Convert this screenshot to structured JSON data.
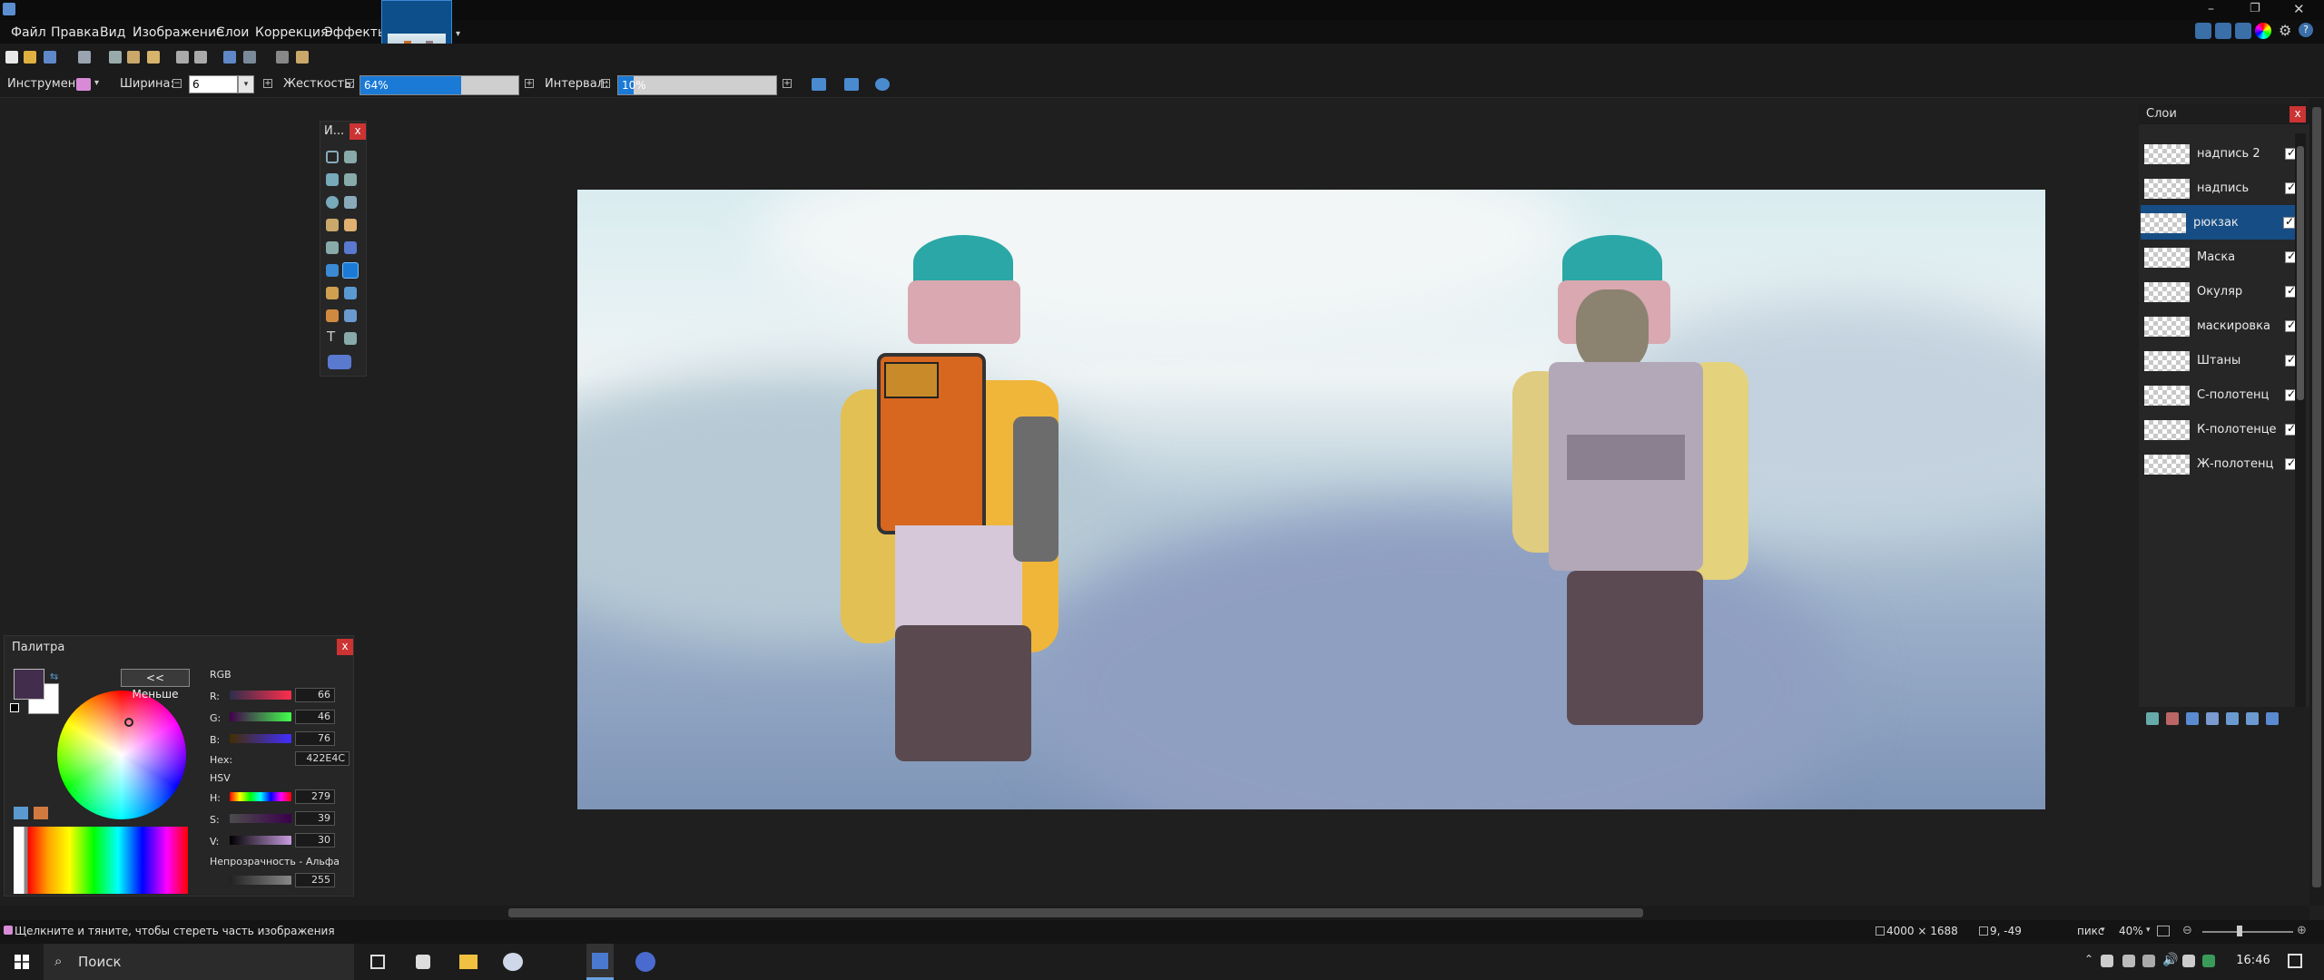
{
  "menu": [
    "Файл",
    "Правка",
    "Вид",
    "Изображение",
    "Слои",
    "Коррекция",
    "Эффекты"
  ],
  "toolbar": {
    "tool_label": "Инструмент:",
    "width_label": "Ширина:",
    "width_value": "6",
    "hardness_label": "Жесткость:",
    "hardness_value": "64%",
    "hardness_level": 0.64,
    "interval_label": "Интервал:",
    "interval_value": "10%",
    "interval_level": 0.1
  },
  "tools_panel": {
    "title": "И...",
    "close": "x"
  },
  "layers_panel": {
    "title": "Слои",
    "close": "x",
    "selected_index": 2,
    "items": [
      {
        "name": "надпись 2",
        "visible": true
      },
      {
        "name": "надпись",
        "visible": true
      },
      {
        "name": "рюкзак",
        "visible": true
      },
      {
        "name": "Маска",
        "visible": true
      },
      {
        "name": "Окуляр",
        "visible": true
      },
      {
        "name": "маскировка",
        "visible": true
      },
      {
        "name": "Штаны",
        "visible": true
      },
      {
        "name": "С-полотенц",
        "visible": true
      },
      {
        "name": "К-полотенце",
        "visible": true
      },
      {
        "name": "Ж-полотенц",
        "visible": true
      }
    ]
  },
  "palette": {
    "title": "Палитра",
    "close": "x",
    "less_button": "<< Меньше",
    "rgb_label": "RGB",
    "r_label": "R:",
    "r_value": "66",
    "g_label": "G:",
    "g_value": "46",
    "b_label": "B:",
    "b_value": "76",
    "hex_label": "Hex:",
    "hex_value": "422E4C",
    "hsv_label": "HSV",
    "h_label": "H:",
    "h_value": "279",
    "s_label": "S:",
    "s_value": "39",
    "v_label": "V:",
    "v_value": "30",
    "alpha_label": "Непрозрачность - Альфа",
    "alpha_value": "255",
    "primary_color": "#422E4C",
    "secondary_color": "#FFFFFF"
  },
  "status": {
    "hint": "Щелкните и тяните, чтобы стереть часть изображения",
    "image_size": "4000 × 1688",
    "cursor_pos": "9, -49",
    "units": "пикс",
    "zoom": "40%"
  },
  "taskbar": {
    "search_placeholder": "Поиск",
    "time": "16:46"
  },
  "colors": {
    "accent": "#1a7ad6",
    "selected_layer": "#164d85",
    "close_red": "#cc3333"
  }
}
